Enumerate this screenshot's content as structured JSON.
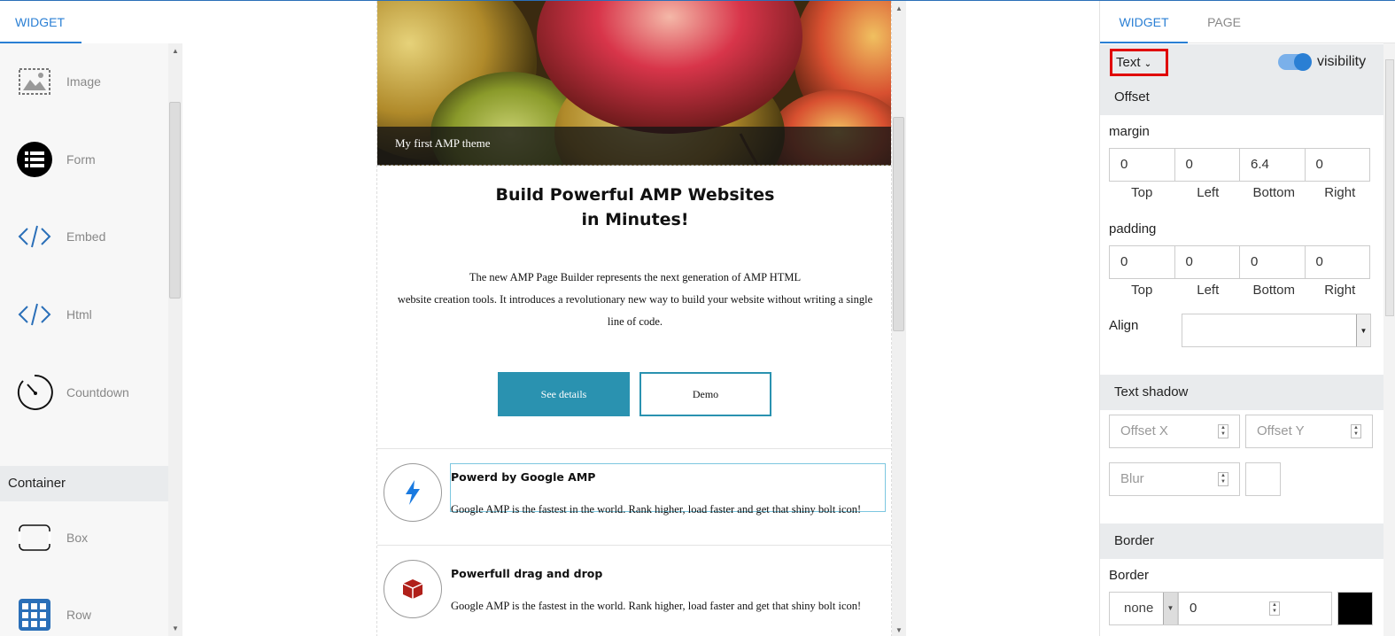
{
  "left_panel": {
    "tab": "WIDGET",
    "widgets": [
      {
        "label": "Image",
        "icon": "image-icon"
      },
      {
        "label": "Form",
        "icon": "form-list-icon"
      },
      {
        "label": "Embed",
        "icon": "code-icon"
      },
      {
        "label": "Html",
        "icon": "code-icon"
      },
      {
        "label": "Countdown",
        "icon": "timer-icon"
      }
    ],
    "section": "Container",
    "containers": [
      {
        "label": "Box",
        "icon": "box-icon"
      },
      {
        "label": "Row",
        "icon": "grid-icon"
      }
    ]
  },
  "canvas": {
    "hero_caption": "My first AMP theme",
    "headline_line1": "Build Powerful AMP Websites",
    "headline_line2": "in Minutes!",
    "desc_line1": "The new AMP Page Builder represents the next generation of AMP HTML",
    "desc_line2": "website creation tools. It introduces a revolutionary new way to build your website without writing a single",
    "desc_line3": "line of code.",
    "btn_primary": "See details",
    "btn_secondary": "Demo",
    "features": [
      {
        "title": "Powerd by Google AMP",
        "text": "Google AMP is the fastest in the world. Rank higher, load faster and get that shiny bolt icon!",
        "icon": "bolt-icon"
      },
      {
        "title": "Powerfull drag and drop",
        "text": "Google AMP is the fastest in the world. Rank higher, load faster and get that shiny bolt icon!",
        "icon": "cube-icon"
      }
    ]
  },
  "right_panel": {
    "tab_widget": "WIDGET",
    "tab_page": "PAGE",
    "type_select": "Text",
    "visibility_label": "visibility",
    "visibility_on": true,
    "offset_header": "Offset",
    "margin_label": "margin",
    "margin": {
      "top": "0",
      "left": "0",
      "bottom": "6.4",
      "right": "0"
    },
    "padding_label": "padding",
    "padding": {
      "top": "0",
      "left": "0",
      "bottom": "0",
      "right": "0"
    },
    "side_labels": {
      "top": "Top",
      "left": "Left",
      "bottom": "Bottom",
      "right": "Right"
    },
    "align_label": "Align",
    "text_shadow_header": "Text shadow",
    "offset_x_placeholder": "Offset X",
    "offset_y_placeholder": "Offset Y",
    "blur_placeholder": "Blur",
    "border_header": "Border",
    "border_label": "Border",
    "border_style": "none",
    "border_width": "0",
    "border_color": "#000000"
  }
}
